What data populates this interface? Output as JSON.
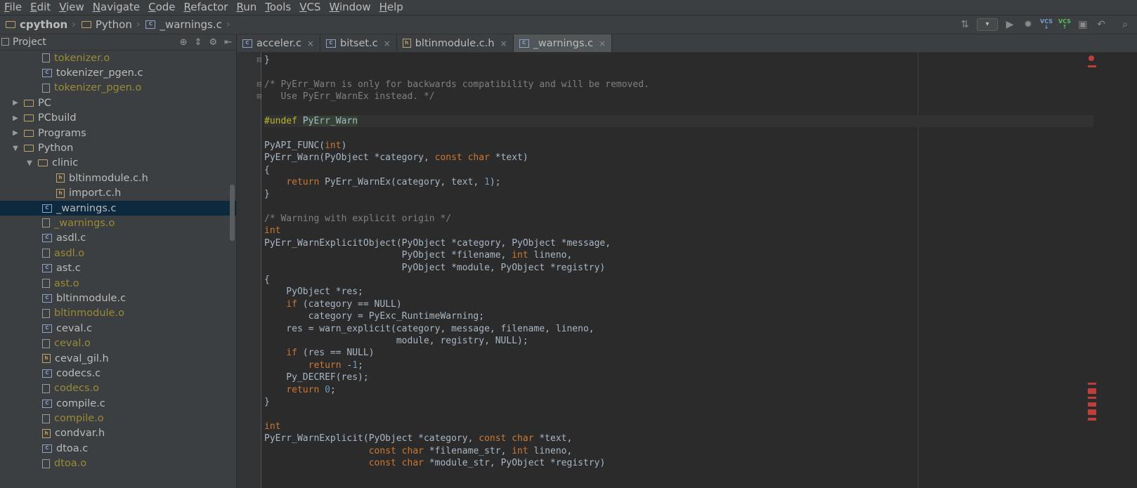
{
  "menu": [
    "File",
    "Edit",
    "View",
    "Navigate",
    "Code",
    "Refactor",
    "Run",
    "Tools",
    "VCS",
    "Window",
    "Help"
  ],
  "breadcrumb": [
    {
      "label": "cpython",
      "icon": "folder-icon"
    },
    {
      "label": "Python",
      "icon": "folder-icon"
    },
    {
      "label": "_warnings.c",
      "icon": "c-file-icon"
    }
  ],
  "toolbar": {
    "vcs_update": "VCS",
    "vcs_commit": "VCS"
  },
  "project": {
    "title": "Project",
    "tree": [
      {
        "label": "tokenizer.o",
        "type": "o",
        "depth": 3,
        "ignored": true
      },
      {
        "label": "tokenizer_pgen.c",
        "type": "c",
        "depth": 3
      },
      {
        "label": "tokenizer_pgen.o",
        "type": "o",
        "depth": 3,
        "ignored": true
      },
      {
        "label": "PC",
        "type": "folder",
        "depth": 1,
        "expanded": false
      },
      {
        "label": "PCbuild",
        "type": "folder",
        "depth": 1,
        "expanded": false
      },
      {
        "label": "Programs",
        "type": "folder",
        "depth": 1,
        "expanded": false
      },
      {
        "label": "Python",
        "type": "folder",
        "depth": 1,
        "expanded": true
      },
      {
        "label": "clinic",
        "type": "folder",
        "depth": 2,
        "expanded": true
      },
      {
        "label": "bltinmodule.c.h",
        "type": "h",
        "depth": 4
      },
      {
        "label": "import.c.h",
        "type": "h",
        "depth": 4
      },
      {
        "label": "_warnings.c",
        "type": "c",
        "depth": 3,
        "selected": true
      },
      {
        "label": "_warnings.o",
        "type": "o",
        "depth": 3,
        "ignored": true
      },
      {
        "label": "asdl.c",
        "type": "c",
        "depth": 3
      },
      {
        "label": "asdl.o",
        "type": "o",
        "depth": 3,
        "ignored": true
      },
      {
        "label": "ast.c",
        "type": "c",
        "depth": 3
      },
      {
        "label": "ast.o",
        "type": "o",
        "depth": 3,
        "ignored": true
      },
      {
        "label": "bltinmodule.c",
        "type": "c",
        "depth": 3
      },
      {
        "label": "bltinmodule.o",
        "type": "o",
        "depth": 3,
        "ignored": true
      },
      {
        "label": "ceval.c",
        "type": "c",
        "depth": 3
      },
      {
        "label": "ceval.o",
        "type": "o",
        "depth": 3,
        "ignored": true
      },
      {
        "label": "ceval_gil.h",
        "type": "h",
        "depth": 3
      },
      {
        "label": "codecs.c",
        "type": "c",
        "depth": 3
      },
      {
        "label": "codecs.o",
        "type": "o",
        "depth": 3,
        "ignored": true
      },
      {
        "label": "compile.c",
        "type": "c",
        "depth": 3
      },
      {
        "label": "compile.o",
        "type": "o",
        "depth": 3,
        "ignored": true
      },
      {
        "label": "condvar.h",
        "type": "h",
        "depth": 3
      },
      {
        "label": "dtoa.c",
        "type": "c",
        "depth": 3
      },
      {
        "label": "dtoa.o",
        "type": "o",
        "depth": 3,
        "ignored": true
      }
    ]
  },
  "tabs": [
    {
      "label": "acceler.c",
      "icon": "c-file-icon",
      "active": false
    },
    {
      "label": "bitset.c",
      "icon": "c-file-icon",
      "active": false
    },
    {
      "label": "bltinmodule.c.h",
      "icon": "h-file-icon",
      "active": false
    },
    {
      "label": "_warnings.c",
      "icon": "c-file-icon",
      "active": true
    }
  ],
  "code": [
    [
      [
        "}",
        ""
      ]
    ],
    [
      [
        "",
        ""
      ]
    ],
    [
      [
        "/* PyErr_Warn is only for backwards compatibility and will be removed.",
        "cm"
      ]
    ],
    [
      [
        "   Use PyErr_WarnEx instead. */",
        "cm"
      ]
    ],
    [
      [
        "",
        ""
      ]
    ],
    [
      [
        "#undef ",
        "pp"
      ],
      [
        "PyErr_Warn",
        "macro"
      ]
    ],
    [
      [
        "",
        ""
      ]
    ],
    [
      [
        "PyAPI_FUNC(",
        ""
      ],
      [
        "int",
        "kw"
      ],
      [
        ")",
        ""
      ]
    ],
    [
      [
        "PyErr_Warn(PyObject *category, ",
        ""
      ],
      [
        "const char",
        "kw"
      ],
      [
        " *text)",
        ""
      ]
    ],
    [
      [
        "{",
        ""
      ]
    ],
    [
      [
        "    ",
        ""
      ],
      [
        "return",
        "kw"
      ],
      [
        " PyErr_WarnEx(category, text, ",
        ""
      ],
      [
        "1",
        "num"
      ],
      [
        ");",
        ""
      ]
    ],
    [
      [
        "}",
        ""
      ]
    ],
    [
      [
        "",
        ""
      ]
    ],
    [
      [
        "/* Warning with explicit origin */",
        "cm"
      ]
    ],
    [
      [
        "int",
        "kw"
      ]
    ],
    [
      [
        "PyErr_WarnExplicitObject(PyObject *category, PyObject *message,",
        ""
      ]
    ],
    [
      [
        "                         PyObject *filename, ",
        ""
      ],
      [
        "int",
        "kw"
      ],
      [
        " lineno,",
        ""
      ]
    ],
    [
      [
        "                         PyObject *module, PyObject *registry)",
        ""
      ]
    ],
    [
      [
        "{",
        ""
      ]
    ],
    [
      [
        "    PyObject *res;",
        ""
      ]
    ],
    [
      [
        "    ",
        ""
      ],
      [
        "if",
        "kw"
      ],
      [
        " (category == NULL)",
        ""
      ]
    ],
    [
      [
        "        category = PyExc_RuntimeWarning;",
        ""
      ]
    ],
    [
      [
        "    res = warn_explicit(category, message, filename, lineno,",
        ""
      ]
    ],
    [
      [
        "                        module, registry, NULL);",
        ""
      ]
    ],
    [
      [
        "    ",
        ""
      ],
      [
        "if",
        "kw"
      ],
      [
        " (res == NULL)",
        ""
      ]
    ],
    [
      [
        "        ",
        ""
      ],
      [
        "return",
        "kw"
      ],
      [
        " -",
        ""
      ],
      [
        "1",
        "num"
      ],
      [
        ";",
        ""
      ]
    ],
    [
      [
        "    Py_DECREF(res);",
        ""
      ]
    ],
    [
      [
        "    ",
        ""
      ],
      [
        "return",
        "kw"
      ],
      [
        " ",
        ""
      ],
      [
        "0",
        "num"
      ],
      [
        ";",
        ""
      ]
    ],
    [
      [
        "}",
        ""
      ]
    ],
    [
      [
        "",
        ""
      ]
    ],
    [
      [
        "int",
        "kw"
      ]
    ],
    [
      [
        "PyErr_WarnExplicit(PyObject *category, ",
        ""
      ],
      [
        "const char",
        "kw"
      ],
      [
        " *text,",
        ""
      ]
    ],
    [
      [
        "                   ",
        ""
      ],
      [
        "const char",
        "kw"
      ],
      [
        " *filename_str, ",
        ""
      ],
      [
        "int",
        "kw"
      ],
      [
        " lineno,",
        ""
      ]
    ],
    [
      [
        "                   ",
        ""
      ],
      [
        "const char",
        "kw"
      ],
      [
        " *module_str, PyObject *registry)",
        ""
      ]
    ]
  ],
  "colors": {
    "background": "#2b2b2b",
    "panel": "#3c3f41",
    "keyword": "#cc7832",
    "comment": "#808080",
    "number": "#6897bb",
    "selection": "#0d293e"
  }
}
